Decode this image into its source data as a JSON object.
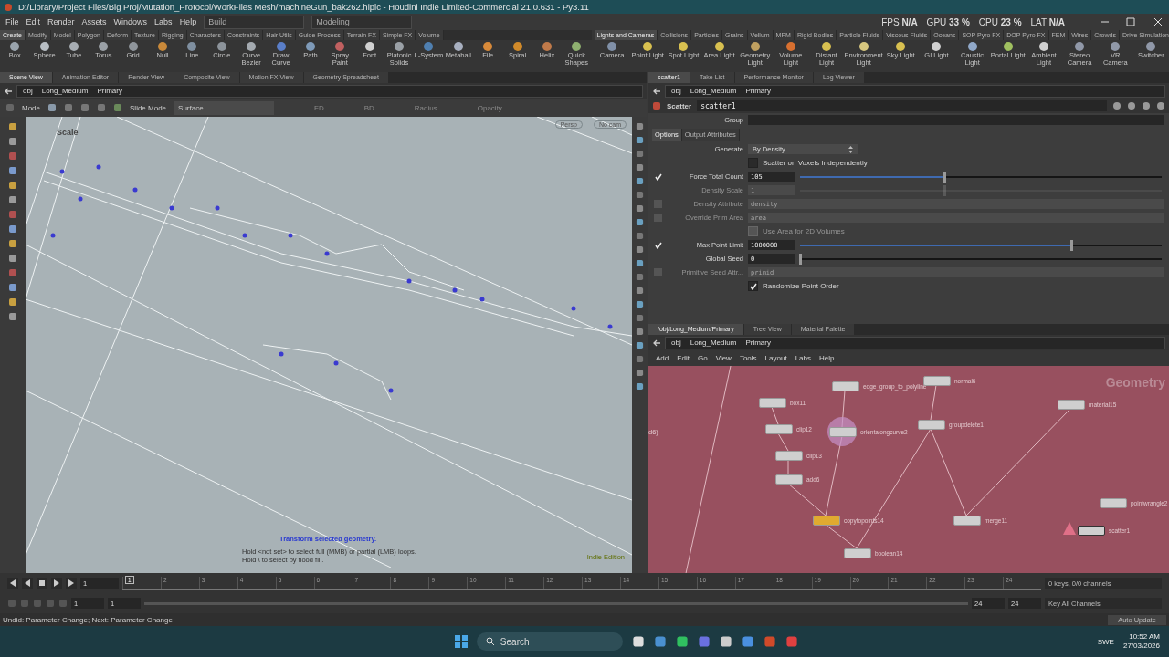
{
  "window": {
    "title": "D:/Library/Project Files/Big Proj/Mutation_Protocol/WorkFiles Mesh/machineGun_bak262.hiplc - Houdini Indie Limited-Commercial 21.0.631 - Py3.11"
  },
  "menu": [
    "File",
    "Edit",
    "Render",
    "Assets",
    "Windows",
    "Labs",
    "Help"
  ],
  "build_set": "Build",
  "desktop": "Modeling",
  "performance": [
    {
      "label": "FPS",
      "value": "N/A"
    },
    {
      "label": "GPU",
      "value": "33 %"
    },
    {
      "label": "CPU",
      "value": "23 %"
    },
    {
      "label": "LAT",
      "value": "N/A"
    }
  ],
  "shelves": [
    {
      "tabs": [
        {
          "label": "Create",
          "selected": true
        },
        {
          "label": "Modify",
          "selected": false
        },
        {
          "label": "Model",
          "selected": false
        },
        {
          "label": "Polygon",
          "selected": false
        },
        {
          "label": "Deform",
          "selected": false
        },
        {
          "label": "Texture",
          "selected": false
        },
        {
          "label": "Rigging",
          "selected": false
        },
        {
          "label": "Characters",
          "selected": false
        },
        {
          "label": "Constraints",
          "selected": false
        },
        {
          "label": "Hair Utils",
          "selected": false
        },
        {
          "label": "Guide Process",
          "selected": false
        },
        {
          "label": "Terrain FX",
          "selected": false
        },
        {
          "label": "Simple FX",
          "selected": false
        },
        {
          "label": "Volume",
          "selected": false
        }
      ],
      "tools": [
        {
          "label": "Box",
          "color": "#9aa4ad"
        },
        {
          "label": "Sphere",
          "color": "#b8bec4"
        },
        {
          "label": "Tube",
          "color": "#a7adb3"
        },
        {
          "label": "Torus",
          "color": "#9aa0a6"
        },
        {
          "label": "Grid",
          "color": "#8f959b"
        },
        {
          "label": "Null",
          "color": "#c9893a"
        },
        {
          "label": "Line",
          "color": "#7f8fa0"
        },
        {
          "label": "Circle",
          "color": "#8c939a"
        },
        {
          "label": "Curve Bezier",
          "color": "#a4aab0"
        },
        {
          "label": "Draw Curve",
          "color": "#5a7ec8"
        },
        {
          "label": "Path",
          "color": "#7e9ab8"
        },
        {
          "label": "Spray Paint",
          "color": "#c06060"
        },
        {
          "label": "Font",
          "color": "#d0d0d0"
        },
        {
          "label": "Platonic Solids",
          "color": "#9aa0a6"
        },
        {
          "label": "L-System",
          "color": "#4f7fb0"
        },
        {
          "label": "Metaball",
          "color": "#a8b0c0"
        },
        {
          "label": "File",
          "color": "#d88a3a"
        },
        {
          "label": "Spiral",
          "color": "#d08a2a"
        },
        {
          "label": "Helix",
          "color": "#c07a4a"
        },
        {
          "label": "Quick Shapes",
          "color": "#8fb070"
        }
      ]
    },
    {
      "tabs": [
        {
          "label": "Lights and Cameras",
          "selected": true
        },
        {
          "label": "Collisions",
          "selected": false
        },
        {
          "label": "Particles",
          "selected": false
        },
        {
          "label": "Grains",
          "selected": false
        },
        {
          "label": "Vellum",
          "selected": false
        },
        {
          "label": "MPM",
          "selected": false
        },
        {
          "label": "Rigid Bodies",
          "selected": false
        },
        {
          "label": "Particle Fluids",
          "selected": false
        },
        {
          "label": "Viscous Fluids",
          "selected": false
        },
        {
          "label": "Oceans",
          "selected": false
        },
        {
          "label": "SOP Pyro FX",
          "selected": false
        },
        {
          "label": "DOP Pyro FX",
          "selected": false
        },
        {
          "label": "FEM",
          "selected": false
        },
        {
          "label": "Wires",
          "selected": false
        },
        {
          "label": "Crowds",
          "selected": false
        },
        {
          "label": "Drive Simulation",
          "selected": false
        }
      ],
      "tools": [
        {
          "label": "Camera",
          "color": "#8090a8"
        },
        {
          "label": "Point Light",
          "color": "#d8c050"
        },
        {
          "label": "Spot Light",
          "color": "#d8c050"
        },
        {
          "label": "Area Light",
          "color": "#d8c050"
        },
        {
          "label": "Geometry Light",
          "color": "#c0a060"
        },
        {
          "label": "Volume Light",
          "color": "#d87030"
        },
        {
          "label": "Distant Light",
          "color": "#d8c050"
        },
        {
          "label": "Environment Light",
          "color": "#d8c880"
        },
        {
          "label": "Sky Light",
          "color": "#d8c050"
        },
        {
          "label": "GI Light",
          "color": "#d0d0d0"
        },
        {
          "label": "Caustic Light",
          "color": "#90a8c8"
        },
        {
          "label": "Portal Light",
          "color": "#a0c060"
        },
        {
          "label": "Ambient Light",
          "color": "#d0d0d0"
        },
        {
          "label": "Stereo Camera",
          "color": "#9098a8"
        },
        {
          "label": "VR Camera",
          "color": "#9098a8"
        },
        {
          "label": "Switcher",
          "color": "#9098a8"
        }
      ]
    }
  ],
  "viewer": {
    "tabs": [
      {
        "label": "Scene View",
        "selected": true
      },
      {
        "label": "Animation Editor",
        "selected": false
      },
      {
        "label": "Render View",
        "selected": false
      },
      {
        "label": "Composite View",
        "selected": false
      },
      {
        "label": "Motion FX View",
        "selected": false
      },
      {
        "label": "Geometry Spreadsheet",
        "selected": false
      }
    ],
    "path": [
      "obj",
      "Long_Medium",
      "Primary"
    ],
    "toolbar": {
      "mode_label": "Mode",
      "slide_mode": "Slide Mode",
      "surface": "Surface",
      "fields": [
        "FD",
        "BD",
        "Radius",
        "Opacity"
      ]
    },
    "tool_name": "Scale",
    "camera": "Persp",
    "cam_menu": "No cam",
    "messages": [
      "Transform selected geometry.",
      "Hold <not set> to select full (MMB) or partial (LMB) loops.",
      "Hold \\ to select by flood fill."
    ],
    "edition": "Indie Edition"
  },
  "parameters": {
    "tabs": [
      {
        "label": "scatter1",
        "selected": true
      },
      {
        "label": "Take List",
        "selected": false
      },
      {
        "label": "Performance Monitor",
        "selected": false
      },
      {
        "label": "Log Viewer",
        "selected": false
      }
    ],
    "path": [
      "obj",
      "Long_Medium",
      "Primary"
    ],
    "node_type": "Scatter",
    "node_name": "scatter1",
    "group_label": "Group",
    "sections": [
      {
        "label": "Options",
        "selected": true
      },
      {
        "label": "Output Attributes",
        "selected": false
      }
    ],
    "params": [
      {
        "kind": "menu",
        "label": "Generate",
        "value": "By Density",
        "disabled": false
      },
      {
        "kind": "check",
        "label": "Scatter on Voxels Independently",
        "checked": false,
        "disabled": false
      },
      {
        "kind": "slider",
        "label": "Force Total Count",
        "toggle": true,
        "value": "105",
        "level": 0.4,
        "disabled": false
      },
      {
        "kind": "slider",
        "label": "Density Scale",
        "value": "1",
        "level": 0.4,
        "disabled": true
      },
      {
        "kind": "string",
        "label": "Density Attribute",
        "toggle": false,
        "value": "density",
        "disabled": true
      },
      {
        "kind": "string",
        "label": "Override Prim Area",
        "toggle": false,
        "value": "area",
        "disabled": true
      },
      {
        "kind": "check",
        "label": "Use Area for 2D Volumes",
        "checked": false,
        "disabled": true
      },
      {
        "kind": "slider",
        "label": "Max Point Limit",
        "toggle": true,
        "value": "1000000",
        "level": 0.75,
        "disabled": false
      },
      {
        "kind": "slider",
        "label": "Global Seed",
        "value": "0",
        "level": 0,
        "disabled": false
      },
      {
        "kind": "string",
        "label": "Primitive Seed Attr...",
        "toggle": false,
        "value": "primid",
        "disabled": true
      },
      {
        "kind": "check",
        "label": "Randomize Point Order",
        "checked": true,
        "disabled": false
      }
    ]
  },
  "network": {
    "tabs": [
      {
        "label": "/obj/Long_Medium/Primary",
        "selected": true
      },
      {
        "label": "Tree View",
        "selected": false
      },
      {
        "label": "Material Palette",
        "selected": false
      }
    ],
    "path": [
      "obj",
      "Long_Medium",
      "Primary"
    ],
    "menu": [
      "Add",
      "Edit",
      "Go",
      "View",
      "Tools",
      "Layout",
      "Labs",
      "Help"
    ],
    "context_label": "Geometry",
    "edge_label": "d6)",
    "nodes": [
      {
        "name": "edge_group_to_polyline",
        "kind": "normal"
      },
      {
        "name": "normal6",
        "kind": "normal"
      },
      {
        "name": "box11",
        "kind": "normal"
      },
      {
        "name": "clip12",
        "kind": "normal"
      },
      {
        "name": "orientalongcurve2",
        "kind": "highlighted"
      },
      {
        "name": "groupdelete1",
        "kind": "normal"
      },
      {
        "name": "clip13",
        "kind": "normal"
      },
      {
        "name": "material15",
        "kind": "normal"
      },
      {
        "name": "add6",
        "kind": "normal"
      },
      {
        "name": "pointwrangle2",
        "kind": "normal"
      },
      {
        "name": "copytopoints14",
        "kind": "template"
      },
      {
        "name": "merge11",
        "kind": "normal"
      },
      {
        "name": "scatter1",
        "kind": "warning"
      },
      {
        "name": "boolean14",
        "kind": "normal"
      }
    ]
  },
  "timeline": {
    "frame": "1",
    "ticks": [
      "1",
      "2",
      "3",
      "4",
      "5",
      "6",
      "7",
      "8",
      "9",
      "10",
      "11",
      "12",
      "13",
      "14",
      "15",
      "16",
      "17",
      "18",
      "19",
      "20",
      "21",
      "22",
      "23",
      "24"
    ],
    "start": "1",
    "range_start": "1",
    "range_end": "24",
    "end": "24",
    "keys": "0 keys, 0/0 channels",
    "key_menu": "Key All Channels"
  },
  "status": {
    "message": "Undid: Parameter Change; Next: Parameter Change",
    "update_mode": "Auto Update"
  },
  "taskbar": {
    "search": "Search",
    "language": "SWE",
    "time": "10:52 AM",
    "date": "27/03/2026"
  }
}
